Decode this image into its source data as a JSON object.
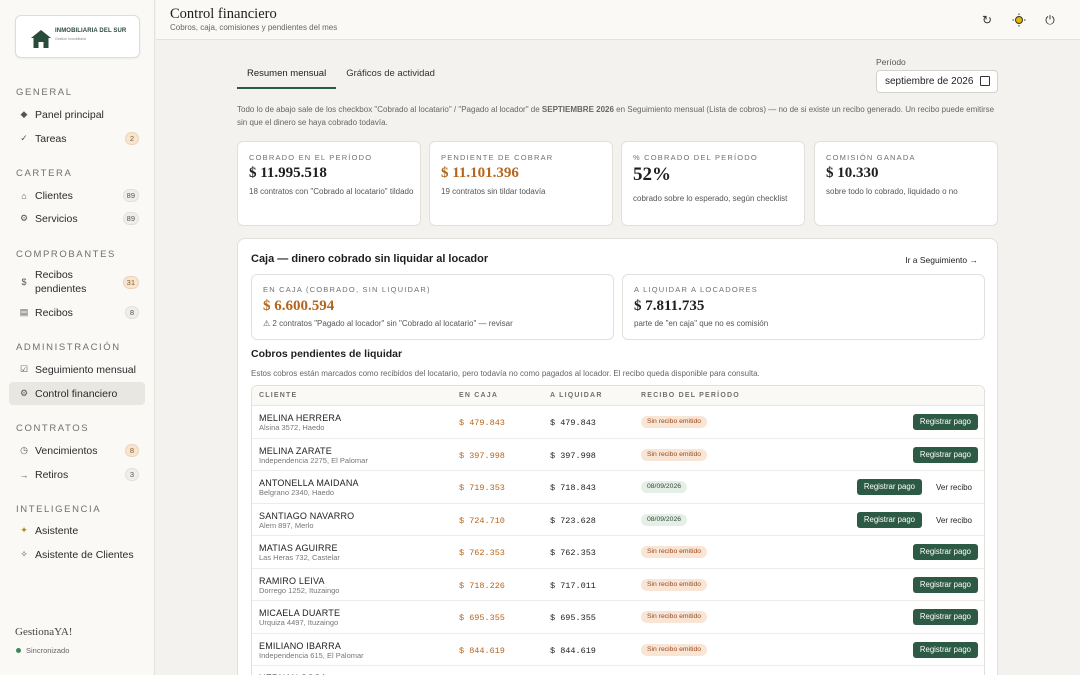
{
  "sidebar": {
    "logo_text": "INMOBILIARIA DEL SUR",
    "logo_sub": "Gestión Inmobiliaria",
    "sections": {
      "general": "GENERAL",
      "cartera": "CARTERA",
      "comprobantes": "COMPROBANTES",
      "administracion": "ADMINISTRACIÓN",
      "contratos": "CONTRATOS",
      "inteligencia": "INTELIGENCIA"
    },
    "items": {
      "panel": {
        "label": "Panel principal",
        "icon": "diamond-icon"
      },
      "tareas": {
        "label": "Tareas",
        "badge": "2",
        "icon": "check-icon"
      },
      "clientes": {
        "label": "Clientes",
        "badge": "89",
        "icon": "home-icon"
      },
      "servicios": {
        "label": "Servicios",
        "badge": "89",
        "icon": "gear-icon"
      },
      "recibos_pendientes": {
        "label": "Recibos pendientes",
        "badge": "31",
        "icon": "dollar-icon"
      },
      "recibos": {
        "label": "Recibos",
        "badge": "8",
        "icon": "receipt-icon"
      },
      "seguimiento": {
        "label": "Seguimiento mensual",
        "icon": "checkbox-icon"
      },
      "control": {
        "label": "Control financiero",
        "icon": "gear-icon"
      },
      "vencimientos": {
        "label": "Vencimientos",
        "badge": "8",
        "icon": "clock-icon"
      },
      "retiros": {
        "label": "Retiros",
        "badge": "3",
        "icon": "exit-icon"
      },
      "asistente": {
        "label": "Asistente",
        "icon": "sparkle-icon"
      },
      "asistente_clientes": {
        "label": "Asistente de Clientes",
        "icon": "chat-icon"
      }
    },
    "brand": "GestionaYA!",
    "sync": "Sincronizado"
  },
  "header": {
    "title": "Control financiero",
    "subtitle": "Cobros, caja, comisiones y pendientes del mes"
  },
  "tabs": [
    "Resumen mensual",
    "Gráficos de actividad"
  ],
  "periodo": {
    "label": "Período",
    "value": "septiembre de 2026"
  },
  "intro": {
    "a": "Todo lo de abajo sale de los checkbox \"Cobrado al locatario\" / \"Pagado al locador\" de ",
    "b": "SEPTIEMBRE 2026",
    "c": " en Seguimiento mensual (Lista de cobros) — no de si existe un recibo generado. Un recibo puede emitirse sin que el dinero se haya cobrado todavía."
  },
  "cards": [
    {
      "label": "COBRADO EN EL PERÍODO",
      "value": "$ 11.995.518",
      "sub": "18 contratos con \"Cobrado al locatario\" tildado"
    },
    {
      "label": "PENDIENTE DE COBRAR",
      "value": "$ 11.101.396",
      "sub": "19 contratos sin tildar todavía"
    },
    {
      "label": "% COBRADO DEL PERÍODO",
      "value": "52%",
      "sub": "cobrado sobre lo esperado, según checklist"
    },
    {
      "label": "COMISIÓN GANADA",
      "value": "$ 10.330",
      "sub": "sobre todo lo cobrado, liquidado o no"
    }
  ],
  "panel": {
    "title": "Caja — dinero cobrado sin liquidar al locador",
    "link": "Ir a Seguimiento →",
    "caja": {
      "label": "EN CAJA (COBRADO, SIN LIQUIDAR)",
      "value": "$ 6.600.594",
      "sub": "⚠ 2 contratos \"Pagado al locador\" sin \"Cobrado al locatario\" — revisar"
    },
    "liquidar": {
      "label": "A LIQUIDAR A LOCADORES",
      "value": "$ 7.811.735",
      "sub": "parte de \"en caja\" que no es comisión"
    },
    "table_title": "Cobros pendientes de liquidar",
    "table_desc": "Estos cobros están marcados como recibidos del locatario, pero todavía no como pagados al locador. El recibo queda disponible para consulta.",
    "columns": [
      "CLIENTE",
      "EN CAJA",
      "A LIQUIDAR",
      "RECIBO DEL PERÍODO"
    ],
    "btn_label": "Registrar pago",
    "ver_label": "Ver recibo",
    "rows": [
      {
        "name": "MELINA HERRERA",
        "addr": "Alsina 3572, Haedo",
        "caja": "$ 479.843",
        "liq": "$ 479.843",
        "recibo": "Sin recibo emitido"
      },
      {
        "name": "MELINA ZARATE",
        "addr": "Independencia 2275, El Palomar",
        "caja": "$ 397.998",
        "liq": "$ 397.998",
        "recibo": "Sin recibo emitido"
      },
      {
        "name": "ANTONELLA MAIDANA",
        "addr": "Belgrano 2340, Haedo",
        "caja": "$ 719.353",
        "liq": "$ 718.843",
        "recibo": "08/09/2026"
      },
      {
        "name": "SANTIAGO NAVARRO",
        "addr": "Alem 897, Merlo",
        "caja": "$ 724.710",
        "liq": "$ 723.628",
        "recibo": "08/09/2026"
      },
      {
        "name": "MATIAS AGUIRRE",
        "addr": "Las Heras 732, Castelar",
        "caja": "$ 762.353",
        "liq": "$ 762.353",
        "recibo": "Sin recibo emitido"
      },
      {
        "name": "RAMIRO LEIVA",
        "addr": "Dorrego 1252, Ituzaingo",
        "caja": "$ 718.226",
        "liq": "$ 717.011",
        "recibo": "Sin recibo emitido"
      },
      {
        "name": "MICAELA DUARTE",
        "addr": "Urquiza 4497, Ituzaingo",
        "caja": "$ 695.355",
        "liq": "$ 695.355",
        "recibo": "Sin recibo emitido"
      },
      {
        "name": "EMILIANO IBARRA",
        "addr": "Independencia 615, El Palomar",
        "caja": "$ 844.619",
        "liq": "$ 844.619",
        "recibo": "Sin recibo emitido"
      },
      {
        "name": "HERNAN SOSA",
        "addr": "",
        "caja": "",
        "liq": "",
        "recibo": ""
      }
    ]
  }
}
